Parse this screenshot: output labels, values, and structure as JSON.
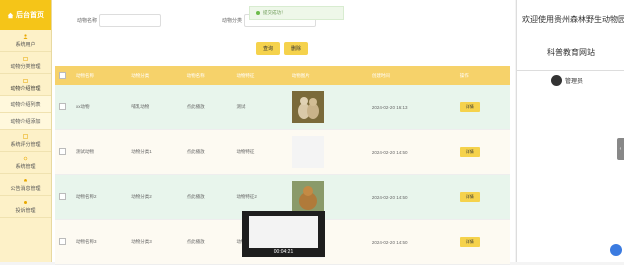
{
  "sidebar": {
    "brand": "后台首页",
    "items": [
      {
        "label": "系统用户"
      },
      {
        "label": "动物分类管理"
      },
      {
        "label": "动物介绍管理"
      },
      {
        "label": "动物介绍列表"
      },
      {
        "label": "动物介绍添加"
      },
      {
        "label": "系统评分管理"
      },
      {
        "label": "系统管理"
      },
      {
        "label": "公告消息管理"
      },
      {
        "label": "投诉管理"
      }
    ]
  },
  "filters": {
    "name_label": "动物名称",
    "category_label": "动物分类",
    "search_label": "查询",
    "delete_label": "删除"
  },
  "toast": "提交成功！",
  "table": {
    "headers": [
      "动物名称",
      "动物分类",
      "动物名称",
      "动物特征",
      "动物图片",
      "创建时间",
      "操作"
    ],
    "rows": [
      {
        "name": "xx动物",
        "category": "哺乳动物",
        "name2": "点此播放",
        "feature": "测试",
        "has_image": true,
        "time": "2024-02-20 16:13",
        "action": "详情"
      },
      {
        "name": "测试动物",
        "category": "动物分类1",
        "name2": "点此播放",
        "feature": "动物特征",
        "has_image": false,
        "time": "2024-02-20 14:50",
        "action": "详情"
      },
      {
        "name": "动物名称2",
        "category": "动物分类2",
        "name2": "点此播放",
        "feature": "动物特征2",
        "has_image": true,
        "time": "2024-02-20 14:50",
        "action": "详情"
      },
      {
        "name": "动物名称3",
        "category": "动物分类3",
        "name2": "点此播放",
        "feature": "动物特征3",
        "has_image": false,
        "time": "2024-02-20 14:50",
        "action": "详情"
      }
    ]
  },
  "right": {
    "welcome": "欢迎使用贵州森林野生动物园",
    "site": "科普教育网站",
    "user": "管理员"
  },
  "video": {
    "time": "00:04:21"
  },
  "colors": {
    "accent": "#f5c518",
    "header": "#f6d26a",
    "row_alt": "#e8f5ec"
  }
}
